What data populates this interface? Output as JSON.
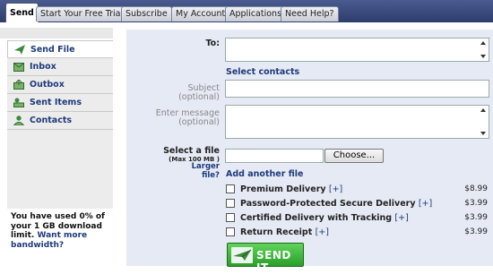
{
  "tabs": [
    {
      "label": "Send",
      "active": true
    },
    {
      "label": "Start Your Free Trial"
    },
    {
      "label": "Subscribe"
    },
    {
      "label": "My Account"
    },
    {
      "label": "Applications"
    },
    {
      "label": "Need Help?"
    }
  ],
  "sidebar": {
    "items": [
      {
        "label": "Send File",
        "icon": "paper-plane-icon"
      },
      {
        "label": "Inbox",
        "icon": "inbox-icon"
      },
      {
        "label": "Outbox",
        "icon": "outbox-icon"
      },
      {
        "label": "Sent Items",
        "icon": "sent-items-icon"
      },
      {
        "label": "Contacts",
        "icon": "contacts-icon"
      }
    ],
    "usage_text": "You have used 0% of your 1 GB download limit.",
    "usage_link": "Want more bandwidth?"
  },
  "form": {
    "to_label": "To:",
    "select_contacts": "Select contacts",
    "subject_label_1": "Subject",
    "subject_label_2": "(optional)",
    "message_label_1": "Enter message",
    "message_label_2": "(optional)",
    "file_label": "Select a file",
    "file_max": "(Max 100 MB )",
    "larger_file": "Larger file?",
    "choose_button": "Choose...",
    "add_another": "Add another file",
    "options": [
      {
        "label": "Premium Delivery",
        "plus": "[+]",
        "price": "$8.99"
      },
      {
        "label": "Password-Protected Secure Delivery",
        "plus": "[+]",
        "price": "$3.99"
      },
      {
        "label": "Certified Delivery with Tracking",
        "plus": "[+]",
        "price": "$3.99"
      },
      {
        "label": "Return Receipt",
        "plus": "[+]",
        "price": "$3.99"
      }
    ],
    "send_button": "SEND IT"
  }
}
